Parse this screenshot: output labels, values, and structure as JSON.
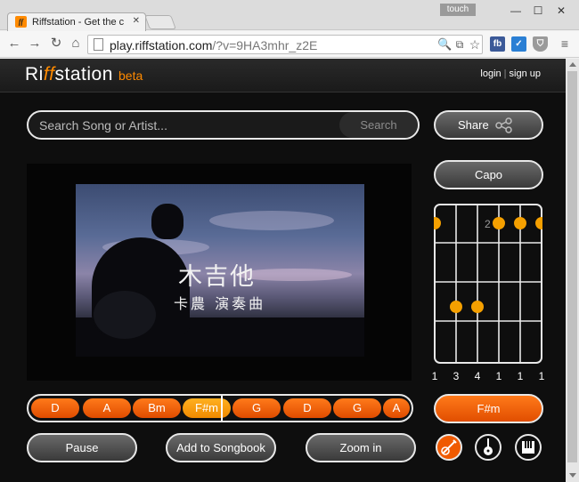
{
  "browser": {
    "tab_title": "Riffstation - Get the c",
    "tab_icon": "ff",
    "touch_label": "touch",
    "url_host": "play.riffstation.com",
    "url_path": "/?v=9HA3mhr_z2E",
    "ext_fb": "fb"
  },
  "header": {
    "logo_pre": "Ri",
    "logo_ff": "ff",
    "logo_post": "station",
    "beta": "beta",
    "login": "login",
    "sep": "|",
    "signup": "sign up"
  },
  "search": {
    "placeholder": "Search Song or Artist...",
    "button": "Search"
  },
  "buttons": {
    "share": "Share",
    "capo": "Capo",
    "current_chord": "F#m",
    "pause": "Pause",
    "add_songbook": "Add to Songbook",
    "zoom_in": "Zoom in"
  },
  "video": {
    "title_text": "木吉他",
    "subtitle_text": "卡農 演奏曲"
  },
  "chord_strip": [
    "D",
    "A",
    "Bm",
    "F#m",
    "G",
    "D",
    "G",
    "A"
  ],
  "chord_diagram": {
    "fingering": [
      "1",
      "3",
      "4",
      "1",
      "1",
      "1"
    ],
    "fret_label": "2"
  },
  "colors": {
    "accent": "#ff8a00",
    "chip": "#f05a00",
    "background": "#0e0e0e"
  }
}
